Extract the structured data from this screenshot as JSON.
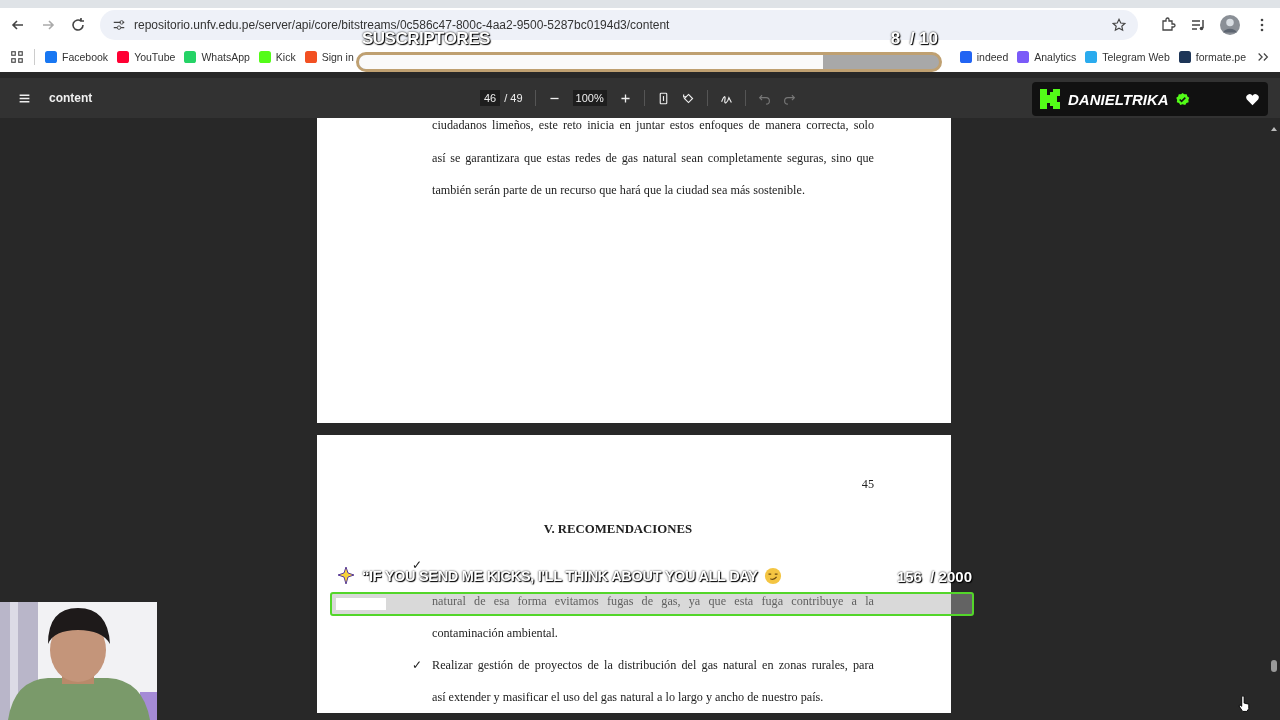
{
  "browser": {
    "url": "repositorio.unfv.edu.pe/server/api/core/bitstreams/0c586c47-800c-4aa2-9500-5287bc0194d3/content",
    "bookmarks": [
      {
        "label": "Facebook",
        "color": "#1877f2"
      },
      {
        "label": "YouTube",
        "color": "#ff0033"
      },
      {
        "label": "WhatsApp",
        "color": "#25d366"
      },
      {
        "label": "Kick",
        "color": "#53fc18"
      },
      {
        "label": "Sign in",
        "color": "#f25022"
      },
      {
        "label": "indeed",
        "color": "#2164f3"
      },
      {
        "label": "Analytics",
        "color": "#7a5af8"
      },
      {
        "label": "Telegram Web",
        "color": "#2aabee"
      },
      {
        "label": "formate.pe",
        "color": "#1d3557"
      }
    ]
  },
  "pdf_toolbar": {
    "title": "content",
    "page": "46",
    "page_total": "/ 49",
    "zoom": "100%"
  },
  "document": {
    "page_a_lines": [
      "ciudadanos limeños, este reto inicia en juntar estos enfoques de manera correcta, solo",
      "así se garantizara que estas redes de gas natural sean completamente seguras, sino que",
      "también serán parte de un recurso que hará que la ciudad sea más sostenible."
    ],
    "page_number": "45",
    "heading": "V. RECOMENDACIONES",
    "bullets": [
      {
        "mark": "✓",
        "lines": [
          "natural de esa forma evitamos fugas de gas, ya que esta fuga contribuye a la",
          "contaminación ambiental."
        ]
      },
      {
        "mark": "✓",
        "lines": [
          "Realizar gestión de proyectos de la distribución del gas natural en zonas rurales, para",
          "así extender y masificar el uso del gas natural a lo largo y ancho de nuestro país."
        ]
      }
    ]
  },
  "overlays": {
    "subscriber_goal": {
      "label": "SUSCRIPTORES",
      "count": "8  / 10",
      "level": 0.8
    },
    "kick_goal": {
      "message": "“IF YOU SEND ME KICKS, I'LL THINK ABOUT YOU ALL DAY",
      "count": "156  / 2000",
      "level": 0.078
    },
    "channel": {
      "name": "DANIELTRIKA",
      "verified": true
    }
  }
}
